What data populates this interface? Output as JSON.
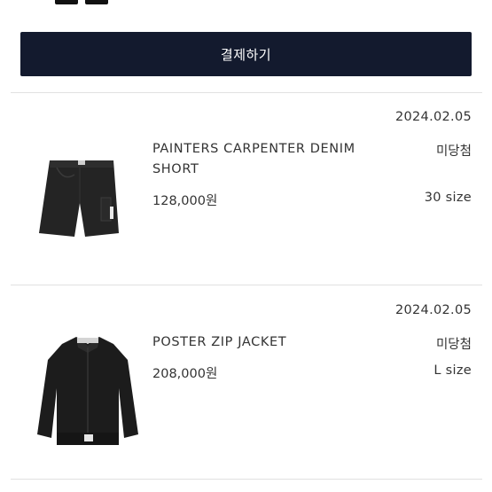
{
  "checkout": {
    "pay_label": "결제하기"
  },
  "orders": [
    {
      "date": "2024.02.05",
      "name": "PAINTERS CARPENTER DENIM SHORT",
      "status": "미당첨",
      "price": "128,000원",
      "size": "30 size",
      "image_icon": "denim-shorts-image"
    },
    {
      "date": "2024.02.05",
      "name": "POSTER ZIP JACKET",
      "status": "미당첨",
      "price": "208,000원",
      "size": "L size",
      "image_icon": "zip-jacket-image"
    }
  ]
}
